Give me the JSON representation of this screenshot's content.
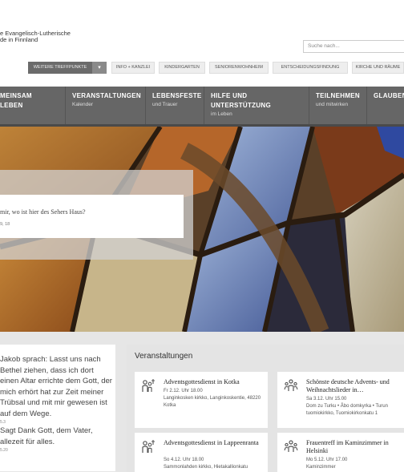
{
  "header": {
    "logo_line1": "e Evangelisch-Lutherische",
    "logo_line2": "de in Finnland",
    "search_placeholder": "Suche nach..."
  },
  "quicklinks": [
    {
      "label": "WEITERE TREFFPUNKTE"
    },
    {
      "label": "INFO + KANZLEI"
    },
    {
      "label": "KINDERGARTEN"
    },
    {
      "label": "SENIORENWOHNHEIM"
    },
    {
      "label": "ENTSCHEIDUNGSFINDUNG"
    },
    {
      "label": "KIRCHE UND RÄUME"
    }
  ],
  "nav": [
    {
      "title1": "MEINSAM",
      "title2": "LEBEN",
      "sub": ""
    },
    {
      "title1": "VERANSTALTUNGEN",
      "title2": "",
      "sub": "Kalender"
    },
    {
      "title1": "LEBENSFESTE",
      "title2": "",
      "sub": "und Trauer"
    },
    {
      "title1": "HILFE UND",
      "title2": "UNTERSTÜTZUNG",
      "sub": "im Leben"
    },
    {
      "title1": "TEILNEHMEN",
      "title2": "",
      "sub": "und mitwirken"
    },
    {
      "title1": "GLAUBEN",
      "title2": "",
      "sub": ""
    }
  ],
  "hero": {
    "quote": "mir, wo ist hier des Sehers Haus?",
    "reference": "9, 18"
  },
  "verse": {
    "text1": "Jakob sprach:  Lasst uns nach Bethel ziehen, dass ich dort einen Altar errichte dem Gott, der mich erhört hat zur Zeit meiner Trübsal und mit mir gewesen ist auf dem Wege.",
    "ref1": "5.3",
    "text2": "Sagt Dank Gott, dem Vater, allezeit für alles.",
    "ref2": "5.20"
  },
  "events": {
    "title": "Veranstaltungen",
    "items": [
      {
        "icon": "people-cross-icon",
        "title": "Adventsgottesdienst in Kotka",
        "date": "Fr 2.12. Uhr 18.00",
        "place": "Langinkosken kirkko, Langinkoskentie, 48220 Kotka"
      },
      {
        "icon": "people-group-icon",
        "title": "Schönste deutsche Advents- und Weihnachtslieder in…",
        "date": "Sa 3.12. Uhr 15.00",
        "place": "Dom zu Turku • Åbo domkyrka • Turun tuomiokirkko, Tuomiokirkonkatu 1"
      },
      {
        "icon": "people-cross-icon",
        "title": "Adventsgottesdienst in Lappeenranta",
        "date": "So 4.12. Uhr 18.00",
        "place": "Sammonlahden kirkko, Hietakallionkatu"
      },
      {
        "icon": "people-group-icon",
        "title": "Frauentreff im Kaminzimmer in Helsinki",
        "date": "Mo 5.12. Uhr 17.00",
        "place": "Kaminzimmer"
      }
    ]
  },
  "colors": {
    "nav_bg": "#666666",
    "quick_dark": "#6b6b6b"
  }
}
